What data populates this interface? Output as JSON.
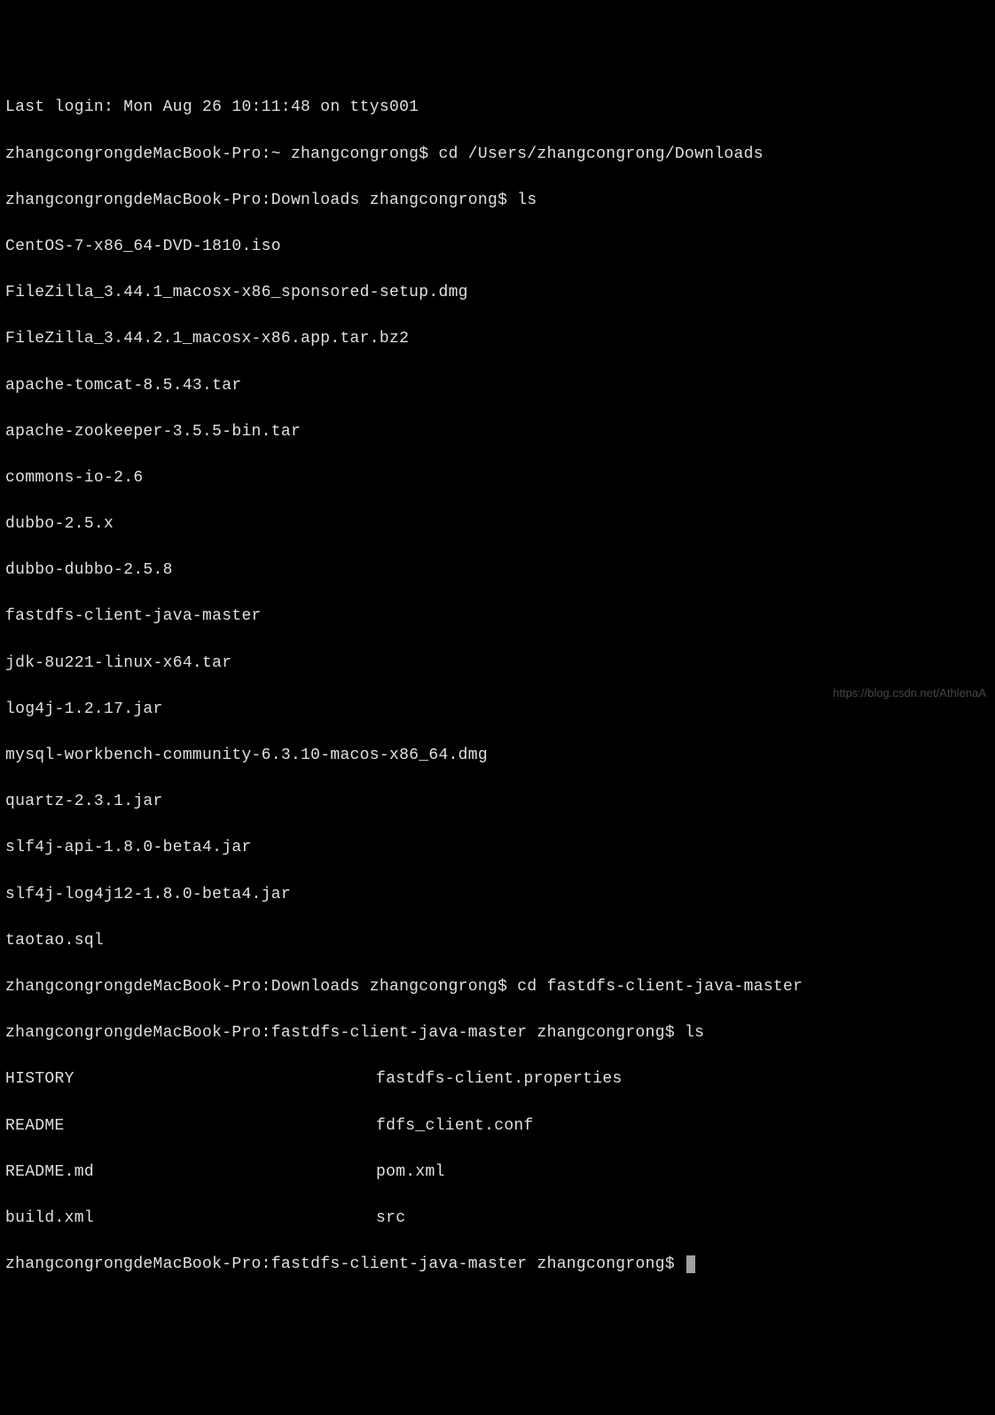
{
  "terminal": {
    "last_login": "Last login: Mon Aug 26 10:11:48 on ttys001",
    "prompt_home": "zhangcongrongdeMacBook-Pro:~ zhangcongrong$ ",
    "cmd_cd_downloads": "cd /Users/zhangcongrong/Downloads",
    "prompt_downloads": "zhangcongrongdeMacBook-Pro:Downloads zhangcongrong$ ",
    "cmd_ls": "ls",
    "ls_downloads": [
      "CentOS-7-x86_64-DVD-1810.iso",
      "FileZilla_3.44.1_macosx-x86_sponsored-setup.dmg",
      "FileZilla_3.44.2.1_macosx-x86.app.tar.bz2",
      "apache-tomcat-8.5.43.tar",
      "apache-zookeeper-3.5.5-bin.tar",
      "commons-io-2.6",
      "dubbo-2.5.x",
      "dubbo-dubbo-2.5.8",
      "fastdfs-client-java-master",
      "jdk-8u221-linux-x64.tar",
      "log4j-1.2.17.jar",
      "mysql-workbench-community-6.3.10-macos-x86_64.dmg",
      "quartz-2.3.1.jar",
      "slf4j-api-1.8.0-beta4.jar",
      "slf4j-log4j12-1.8.0-beta4.jar",
      "taotao.sql"
    ],
    "cmd_cd_fastdfs": "cd fastdfs-client-java-master",
    "prompt_fastdfs": "zhangcongrongdeMacBook-Pro:fastdfs-client-java-master zhangcongrong$ ",
    "ls_fastdfs_left": [
      "HISTORY",
      "README",
      "README.md",
      "build.xml"
    ],
    "ls_fastdfs_right": [
      "fastdfs-client.properties",
      "fdfs_client.conf",
      "pom.xml",
      "src"
    ]
  },
  "watermark": "https://blog.csdn.net/AthlenaA"
}
